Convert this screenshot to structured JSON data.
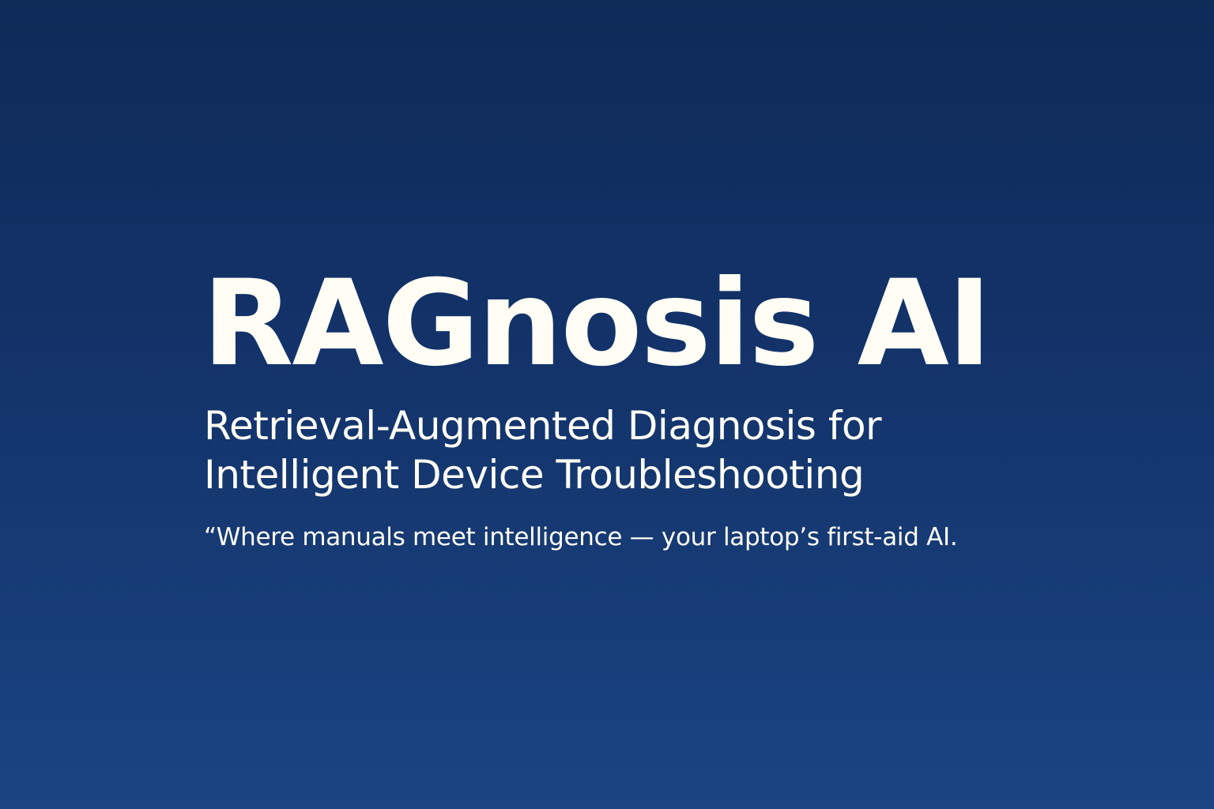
{
  "hero": {
    "title": "RAGnosis AI",
    "subtitle_line1": "Retrieval-Augmented Diagnosis for",
    "subtitle_line2": "Intelligent Device Troubleshooting",
    "tagline": "“Where manuals meet intelligence — your laptop’s first-aid AI."
  },
  "colors": {
    "background_top": "#0e2a57",
    "background_bottom": "#1a4482",
    "text": "#fffdf4"
  }
}
